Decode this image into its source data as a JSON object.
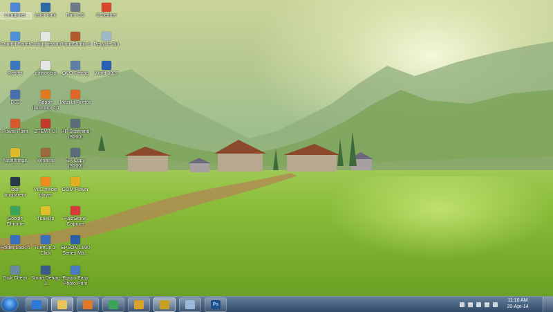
{
  "desktop_icons": [
    {
      "label": "Computer",
      "icon": "computer-icon",
      "color": "#4f87d6",
      "selected": true
    },
    {
      "label": "color bark",
      "icon": "image-file-icon",
      "color": "#2d6aa3"
    },
    {
      "label": "Print CD",
      "icon": "printer-icon",
      "color": "#6c7a88"
    },
    {
      "label": "CCleaner",
      "icon": "ccleaner-icon",
      "color": "#d8462b"
    },
    {
      "label": "Control Panel",
      "icon": "control-panel-icon",
      "color": "#4e8fd8"
    },
    {
      "label": "Coding lesson",
      "icon": "document-icon",
      "color": "#e6e6e6"
    },
    {
      "label": "PhotoStudio 6",
      "icon": "photostudio-icon",
      "color": "#b05a2f"
    },
    {
      "label": "Recycle Bin",
      "icon": "recycle-bin-icon",
      "color": "#9fb8c8"
    },
    {
      "label": "Reflect",
      "icon": "reflect-icon",
      "color": "#3a77c0"
    },
    {
      "label": "author bio",
      "icon": "document-icon",
      "color": "#e6e6e6"
    },
    {
      "label": "O&O Defrag",
      "icon": "defrag-icon",
      "color": "#5f7fa5"
    },
    {
      "label": "Word 2007",
      "icon": "word-icon",
      "color": "#2b5fb4"
    },
    {
      "label": "PS3",
      "icon": "ps3-icon",
      "color": "#4a6fb0"
    },
    {
      "label": "Adobe Illustrator 10",
      "icon": "illustrator-icon",
      "color": "#e07a20"
    },
    {
      "label": "Mozilla Firefox",
      "icon": "firefox-icon",
      "color": "#e0672a"
    },
    {
      "label": "Power Point",
      "icon": "powerpoint-icon",
      "color": "#d65a2e"
    },
    {
      "label": "ZTEMT UI",
      "icon": "ztemt-icon",
      "color": "#c63a2c"
    },
    {
      "label": "HP Scanning (S200)",
      "icon": "scanner-icon",
      "color": "#5c6c7c"
    },
    {
      "label": "NeatImage",
      "icon": "neatimage-icon",
      "color": "#e0b72a"
    },
    {
      "label": "Winamp",
      "icon": "winamp-icon",
      "color": "#9a6a3a"
    },
    {
      "label": "HP Copy (S200)",
      "icon": "copier-icon",
      "color": "#5c6c7c"
    },
    {
      "label": "logo trnsparent",
      "icon": "image-file-icon",
      "color": "#2a3a4a"
    },
    {
      "label": "VLC media player",
      "icon": "vlc-icon",
      "color": "#f08a1c"
    },
    {
      "label": "GOM Player",
      "icon": "gom-player-icon",
      "color": "#e0b020"
    },
    {
      "label": "Google Chrome",
      "icon": "chrome-icon",
      "color": "#3ba35a"
    },
    {
      "label": "TuneUp",
      "icon": "tuneup-icon",
      "color": "#e0c02a"
    },
    {
      "label": "FastStone Capture",
      "icon": "faststone-icon",
      "color": "#d63a3a"
    },
    {
      "label": "Folder Lock 6",
      "icon": "folder-lock-icon",
      "color": "#3a6fc0"
    },
    {
      "label": "TuneUp 1-Click",
      "icon": "tuneup-icon",
      "color": "#3a6fc0"
    },
    {
      "label": "EPSON L800 Series Ma...",
      "icon": "epson-icon",
      "color": "#2a5fa8"
    },
    {
      "label": "Disk Check",
      "icon": "disk-check-icon",
      "color": "#6a8aa0"
    },
    {
      "label": "Smart Defrag 3",
      "icon": "smart-defrag-icon",
      "color": "#3a5a8a"
    },
    {
      "label": "Epson Easy Photo Print",
      "icon": "epson-photo-icon",
      "color": "#4a7ac0"
    }
  ],
  "taskbar": {
    "start_icon": "windows-start-icon",
    "pinned": [
      {
        "icon": "internet-explorer-icon",
        "color": "#2f7ad8"
      },
      {
        "icon": "folder-icon",
        "color": "#e8c55a",
        "active": true
      },
      {
        "icon": "media-player-icon",
        "color": "#e07a2a"
      },
      {
        "icon": "chrome-icon",
        "color": "#3ba35a"
      },
      {
        "icon": "paint-icon",
        "color": "#d8a22a"
      },
      {
        "icon": "winamp-icon",
        "color": "#c8a020",
        "active": true
      },
      {
        "icon": "notepad-icon",
        "color": "#9ab8d8"
      },
      {
        "icon": "photoshop-icon",
        "color": "#1f4e8c",
        "text": "Ps"
      }
    ],
    "tray_icons": [
      "show-hidden-icon",
      "flag-icon",
      "network-icon",
      "signal-icon",
      "volume-icon"
    ],
    "time": "11:10 AM",
    "date": "20-Apr-14"
  }
}
